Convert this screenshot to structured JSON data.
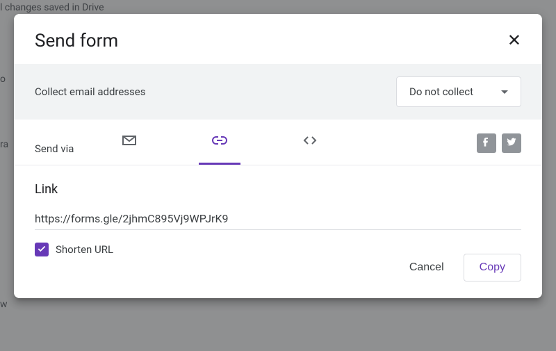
{
  "background": {
    "saved_text": "l changes saved in Drive",
    "left_fragment_1": "o",
    "left_fragment_2": "ra",
    "left_fragment_3": "w"
  },
  "dialog": {
    "title": "Send form",
    "collect": {
      "label": "Collect email addresses",
      "selected": "Do not collect"
    },
    "send_via_label": "Send via",
    "link": {
      "heading": "Link",
      "url": "https://forms.gle/2jhmC895Vj9WPJrK9",
      "shorten_label": "Shorten URL",
      "shorten_checked": true
    },
    "actions": {
      "cancel": "Cancel",
      "copy": "Copy"
    }
  }
}
